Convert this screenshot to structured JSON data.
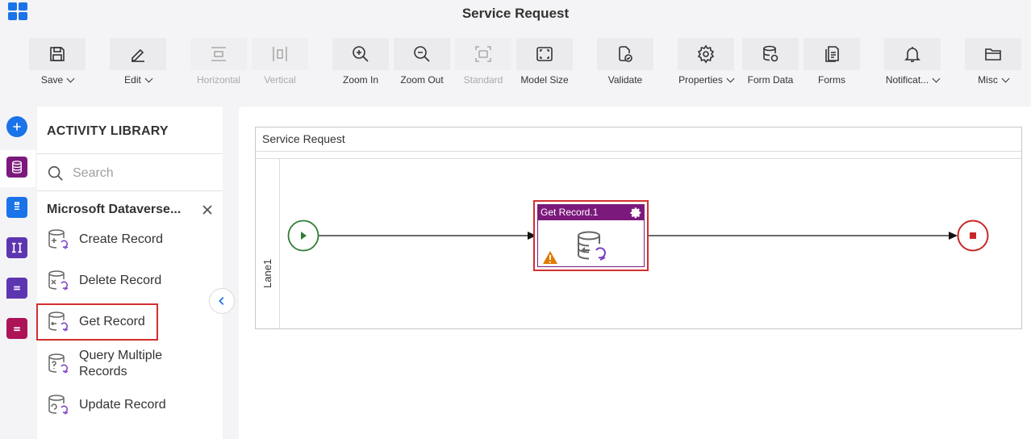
{
  "window": {
    "title": "Service Request"
  },
  "toolbar": {
    "items": [
      {
        "label": "Save",
        "icon": "save-icon",
        "dropdown": true,
        "disabled": false
      },
      {
        "label": "Edit",
        "icon": "edit-icon",
        "dropdown": true,
        "disabled": false
      },
      {
        "label": "Horizontal",
        "icon": "horizontal-icon",
        "dropdown": false,
        "disabled": true
      },
      {
        "label": "Vertical",
        "icon": "vertical-icon",
        "dropdown": false,
        "disabled": true
      },
      {
        "label": "Zoom In",
        "icon": "zoom-in-icon",
        "dropdown": false,
        "disabled": false
      },
      {
        "label": "Zoom Out",
        "icon": "zoom-out-icon",
        "dropdown": false,
        "disabled": false
      },
      {
        "label": "Standard",
        "icon": "standard-icon",
        "dropdown": false,
        "disabled": true
      },
      {
        "label": "Model Size",
        "icon": "model-size-icon",
        "dropdown": false,
        "disabled": false
      },
      {
        "label": "Validate",
        "icon": "validate-icon",
        "dropdown": false,
        "disabled": false
      },
      {
        "label": "Properties",
        "icon": "gear-icon",
        "dropdown": true,
        "disabled": false
      },
      {
        "label": "Form Data",
        "icon": "database-icon",
        "dropdown": false,
        "disabled": false
      },
      {
        "label": "Forms",
        "icon": "forms-icon",
        "dropdown": false,
        "disabled": false
      },
      {
        "label": "Notificat...",
        "icon": "bell-icon",
        "dropdown": true,
        "disabled": false
      },
      {
        "label": "Misc",
        "icon": "folder-icon",
        "dropdown": true,
        "disabled": false
      }
    ]
  },
  "library": {
    "title": "ACTIVITY LIBRARY",
    "search_placeholder": "Search",
    "category": "Microsoft Dataverse...",
    "items": [
      {
        "label": "Create Record",
        "selected": false
      },
      {
        "label": "Delete Record",
        "selected": false
      },
      {
        "label": "Get Record",
        "selected": true
      },
      {
        "label": "Query Multiple Records",
        "selected": false
      },
      {
        "label": "Update Record",
        "selected": false
      }
    ]
  },
  "canvas": {
    "pool_title": "Service Request",
    "lane_label": "Lane1",
    "task_title": "Get Record.1"
  },
  "colors": {
    "accent": "#1a73e8",
    "task_header": "#7b1a7c",
    "selection": "#d32f2f",
    "start_event": "#2e7d32",
    "end_event": "#c62828"
  }
}
